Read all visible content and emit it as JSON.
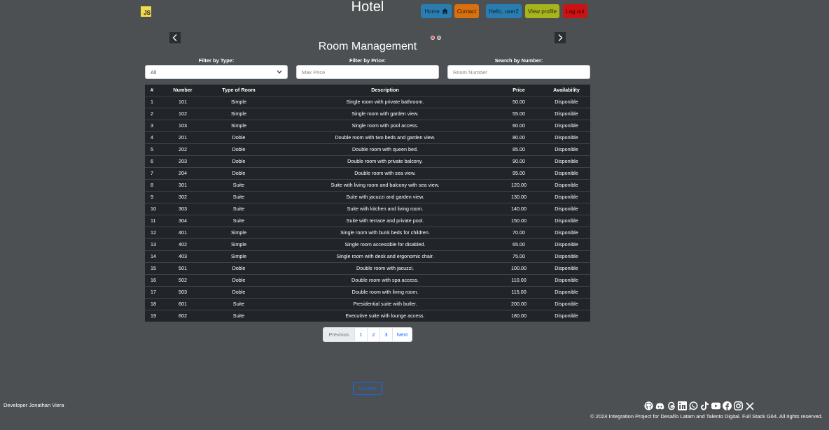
{
  "header": {
    "logo_text": "JS",
    "title": "Hotel",
    "nav": {
      "home": "Home",
      "contact": "Contact",
      "hello": "Hello, user2",
      "view_profile": "View profile",
      "logout": "Log out"
    }
  },
  "main": {
    "title": "Room Management",
    "filters": {
      "type_label": "Filter by Type:",
      "type_value": "All",
      "price_label": "Filter by Price:",
      "price_placeholder": "Max Price",
      "number_label": "Search by Number:",
      "number_placeholder": "Room Number"
    },
    "table": {
      "headers": [
        "#",
        "Number",
        "Type of Room",
        "Description",
        "Price",
        "Availability"
      ],
      "rows": [
        [
          "1",
          "101",
          "Simple",
          "Single room with private bathroom.",
          "50.00",
          "Disponible"
        ],
        [
          "2",
          "102",
          "Simple",
          "Single room with garden view.",
          "55.00",
          "Disponible"
        ],
        [
          "3",
          "103",
          "Simple",
          "Single room with pool access.",
          "60.00",
          "Disponible"
        ],
        [
          "4",
          "201",
          "Doble",
          "Double room with two beds and garden view.",
          "80.00",
          "Disponible"
        ],
        [
          "5",
          "202",
          "Doble",
          "Double room with queen bed.",
          "85.00",
          "Disponible"
        ],
        [
          "6",
          "203",
          "Doble",
          "Double room with private balcony.",
          "90.00",
          "Disponible"
        ],
        [
          "7",
          "204",
          "Doble",
          "Double room with sea view.",
          "95.00",
          "Disponible"
        ],
        [
          "8",
          "301",
          "Suite",
          "Suite with living room and balcony with sea view.",
          "120.00",
          "Disponible"
        ],
        [
          "9",
          "302",
          "Suite",
          "Suite with jacuzzi and garden view.",
          "130.00",
          "Disponible"
        ],
        [
          "10",
          "303",
          "Suite",
          "Suite with kitchen and living room.",
          "140.00",
          "Disponible"
        ],
        [
          "11",
          "304",
          "Suite",
          "Suite with terrace and private pool.",
          "150.00",
          "Disponible"
        ],
        [
          "12",
          "401",
          "Simple",
          "Single room with bunk beds for children.",
          "70.00",
          "Disponible"
        ],
        [
          "13",
          "402",
          "Simple",
          "Single room accessible for disabled.",
          "65.00",
          "Disponible"
        ],
        [
          "14",
          "403",
          "Simple",
          "Single room with desk and ergonomic chair.",
          "75.00",
          "Disponible"
        ],
        [
          "15",
          "501",
          "Doble",
          "Double room with jacuzzi.",
          "100.00",
          "Disponible"
        ],
        [
          "16",
          "502",
          "Doble",
          "Double room with spa access.",
          "110.00",
          "Disponible"
        ],
        [
          "17",
          "503",
          "Doble",
          "Double room with living room.",
          "115.00",
          "Disponible"
        ],
        [
          "18",
          "601",
          "Suite",
          "Presidential suite with butler.",
          "200.00",
          "Disponible"
        ],
        [
          "19",
          "602",
          "Suite",
          "Executive suite with lounge access.",
          "180.00",
          "Disponible"
        ]
      ]
    },
    "pagination": {
      "previous": "Previous",
      "pages": [
        "1",
        "2",
        "3"
      ],
      "next": "Next"
    },
    "contact_button": "Contact"
  },
  "footer": {
    "developer": "Developer Jonathan Viera",
    "copyright": "© 2024 Integration Project for Desafío Latam and Talento Digital. Full Stack G64. All rights reserved.",
    "social_icons": [
      "github-icon",
      "discord-icon",
      "threads-icon",
      "linkedin-icon",
      "whatsapp-icon",
      "tiktok-icon",
      "youtube-icon",
      "facebook-icon",
      "instagram-icon",
      "x-icon"
    ]
  },
  "colors": {
    "background": "#4d5052",
    "table_bg": "#212529",
    "primary": "#0d6efd"
  }
}
